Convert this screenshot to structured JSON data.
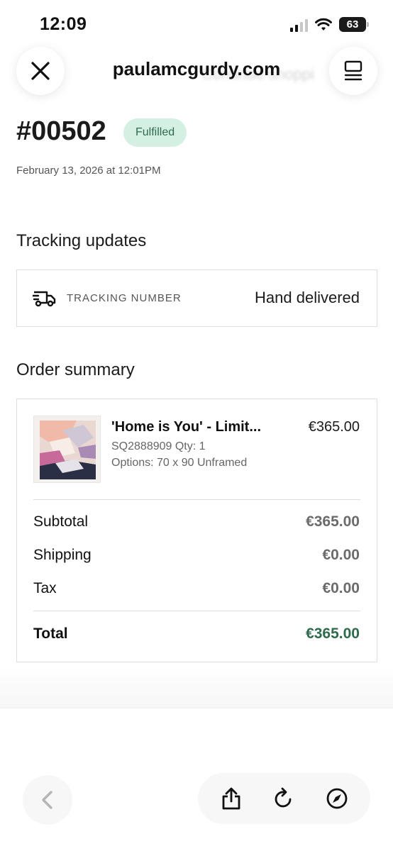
{
  "status_bar": {
    "time": "12:09",
    "battery": "63"
  },
  "header": {
    "site": "paulamcgurdy.com",
    "ghost_text": "Continue shoppi"
  },
  "order": {
    "number": "#00502",
    "status": "Fulfilled",
    "date": "February 13, 2026 at 12:01PM"
  },
  "tracking": {
    "section_title": "Tracking updates",
    "label": "TRACKING NUMBER",
    "value": "Hand delivered"
  },
  "summary": {
    "section_title": "Order summary",
    "item": {
      "name": "'Home is You' - Limit...",
      "price": "€365.00",
      "sku": "SQ2888909 Qty: 1",
      "options": "Options: 70 x 90 Unframed"
    },
    "subtotal_label": "Subtotal",
    "subtotal_value": "€365.00",
    "shipping_label": "Shipping",
    "shipping_value": "€0.00",
    "tax_label": "Tax",
    "tax_value": "€0.00",
    "total_label": "Total",
    "total_value": "€365.00"
  },
  "colors": {
    "badge_bg": "#d4f0e2",
    "accent_green": "#2e6b4d"
  },
  "icons": [
    "close-icon",
    "menu-icon",
    "truck-icon",
    "chevron-left-icon",
    "share-icon",
    "reload-icon",
    "compass-icon",
    "signal-icon",
    "wifi-icon",
    "battery-icon"
  ]
}
